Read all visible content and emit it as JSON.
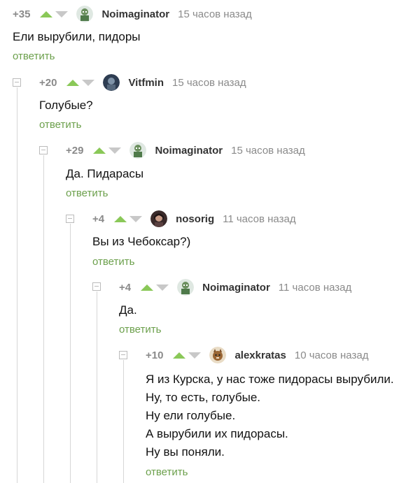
{
  "reply_label": "ответить",
  "colors": {
    "upvote": "#8ac858",
    "downvote": "#c8c8c8",
    "reply": "#6ca04c",
    "meta": "#8a8a8a"
  },
  "comments": [
    {
      "rating": "+35",
      "user": "Noimaginator",
      "avatar_icon": "green-character-avatar-icon",
      "time": "15 часов назад",
      "lines": [
        "Ели вырубили, пидоры"
      ]
    },
    {
      "rating": "+20",
      "user": "Vitfmin",
      "avatar_icon": "dark-blue-avatar-icon",
      "time": "15 часов назад",
      "lines": [
        "Голубые?"
      ]
    },
    {
      "rating": "+29",
      "user": "Noimaginator",
      "avatar_icon": "green-character-avatar-icon",
      "time": "15 часов назад",
      "lines": [
        "Да. Пидарасы"
      ]
    },
    {
      "rating": "+4",
      "user": "nosorig",
      "avatar_icon": "photo-avatar-icon",
      "time": "11 часов назад",
      "lines": [
        "Вы из Чебоксар?)"
      ]
    },
    {
      "rating": "+4",
      "user": "Noimaginator",
      "avatar_icon": "green-character-avatar-icon",
      "time": "11 часов назад",
      "lines": [
        "Да."
      ]
    },
    {
      "rating": "+10",
      "user": "alexkratas",
      "avatar_icon": "brown-cat-avatar-icon",
      "time": "10 часов назад",
      "lines": [
        "Я из Курска, у нас тоже пидорасы вырубили.",
        "Ну, то есть, голубые.",
        "Ну ели голубые.",
        "А вырубили их пидорасы.",
        "Ну вы поняли."
      ]
    }
  ]
}
